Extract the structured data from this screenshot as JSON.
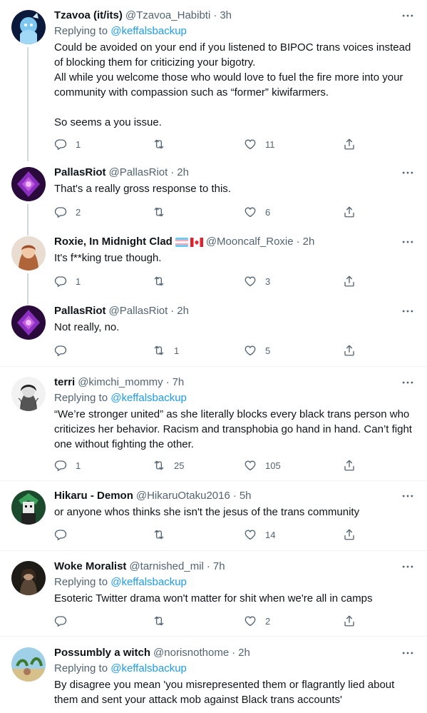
{
  "tweets": [
    {
      "name": "Tzavoa (it/its)",
      "handle": "@Tzavoa_Habibti",
      "time": "3h",
      "replying_prefix": "Replying to ",
      "replying_to": "@keffalsbackup",
      "text": "Could be avoided on your end if you listened to BIPOC trans voices instead of blocking them for criticizing your bigotry.\nAll while you welcome those who would love to fuel the fire more into your community with compassion such as “former” kiwifarmers.\n\nSo seems a you issue.",
      "replies": "1",
      "retweets": "",
      "likes": "11"
    },
    {
      "name": "PallasRiot",
      "handle": "@PallasRiot",
      "time": "2h",
      "text": "That's a really gross response to this.",
      "replies": "2",
      "retweets": "",
      "likes": "6"
    },
    {
      "name": "Roxie, In Midnight Clad",
      "handle": "@Mooncalf_Roxie",
      "time": "2h",
      "text": "It's f**king true though.",
      "replies": "1",
      "retweets": "",
      "likes": "3"
    },
    {
      "name": "PallasRiot",
      "handle": "@PallasRiot",
      "time": "2h",
      "text": "Not really, no.",
      "replies": "",
      "retweets": "1",
      "likes": "5"
    },
    {
      "name": "terri",
      "handle": "@kimchi_mommy",
      "time": "7h",
      "replying_prefix": "Replying to ",
      "replying_to": "@keffalsbackup",
      "text": "“We’re stronger united” as she literally blocks every black trans person who criticizes her behavior. Racism and transphobia go hand in hand. Can’t fight one without fighting the other.",
      "replies": "1",
      "retweets": "25",
      "likes": "105"
    },
    {
      "name": "Hikaru - Demon",
      "handle": "@HikaruOtaku2016",
      "time": "5h",
      "text": "or anyone whos thinks she isn't the jesus of the trans community",
      "replies": "",
      "retweets": "",
      "likes": "14"
    },
    {
      "name": "Woke Moralist",
      "handle": "@tarnished_mil",
      "time": "7h",
      "replying_prefix": "Replying to ",
      "replying_to": "@keffalsbackup",
      "text": "Esoteric Twitter drama won't matter for shit when we're all in camps",
      "replies": "",
      "retweets": "",
      "likes": "2"
    },
    {
      "name": "Possumbly a witch",
      "handle": "@norisnothome",
      "time": "2h",
      "replying_prefix": "Replying to ",
      "replying_to": "@keffalsbackup",
      "text": "By disagree you mean 'you misrepresented them or flagrantly lied about them and sent your attack mob against Black trans accounts'"
    }
  ],
  "separator": "·",
  "colors": {
    "link": "#1d9bf0",
    "muted": "#536471",
    "text": "#0f1419",
    "thread_line": "#cfd9de",
    "divider": "#eff3f4"
  },
  "icons": [
    "reply-icon",
    "retweet-icon",
    "like-icon",
    "share-icon",
    "more-icon",
    "trans-flag-icon",
    "canada-flag-icon"
  ]
}
